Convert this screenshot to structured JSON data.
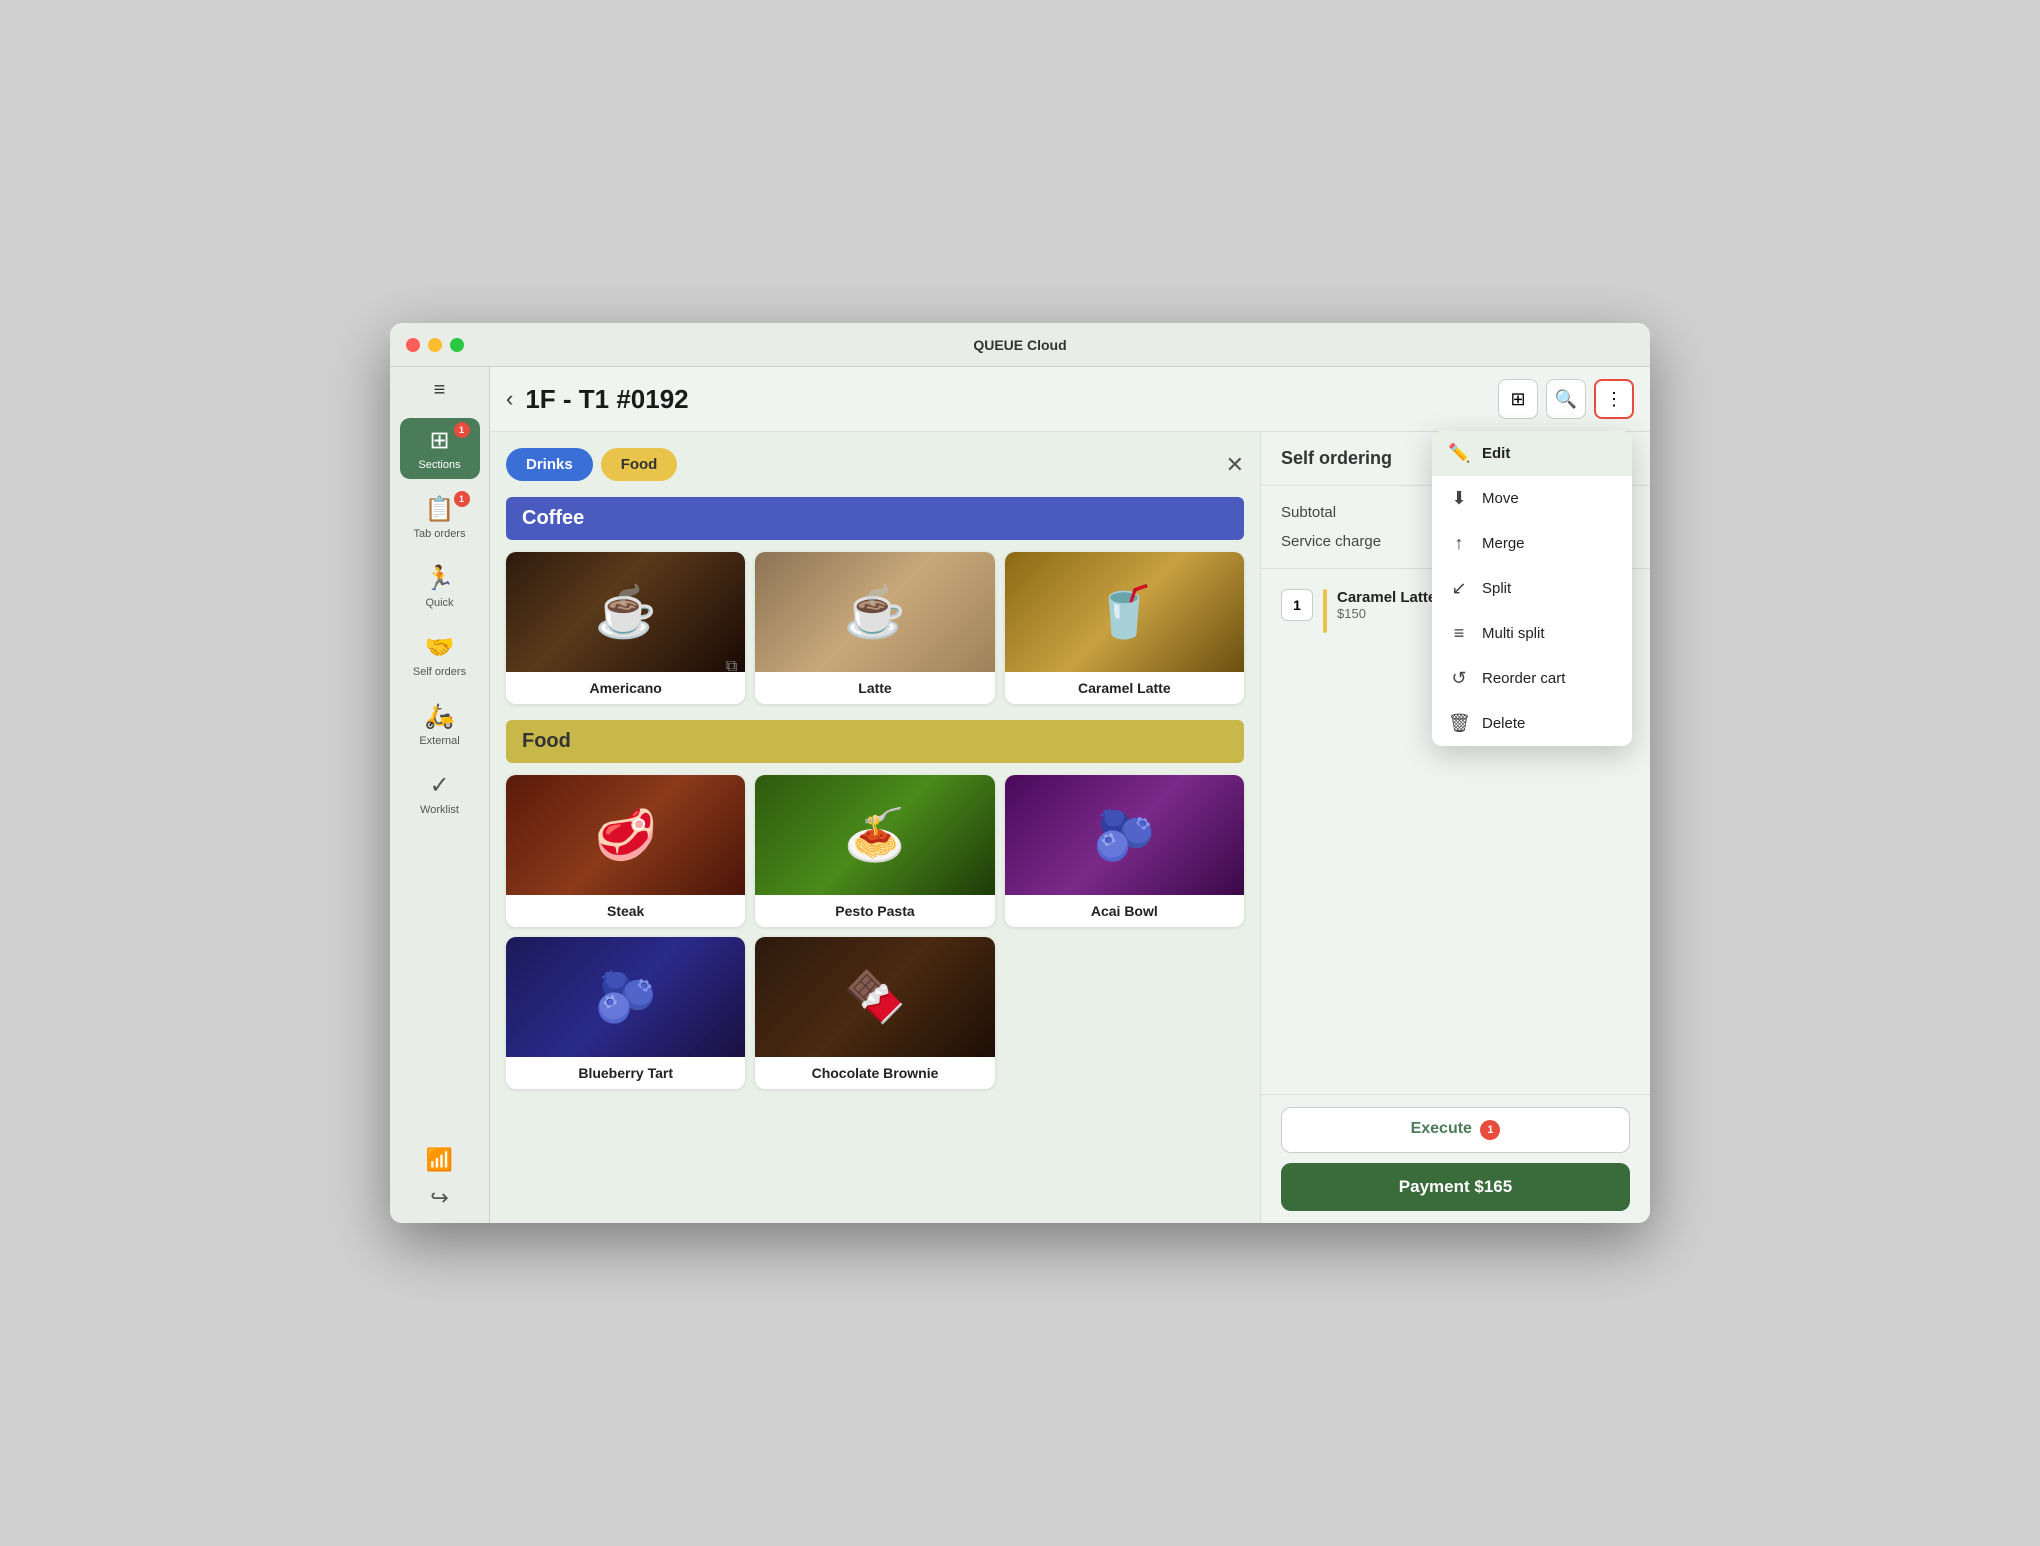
{
  "window": {
    "title": "QUEUE Cloud"
  },
  "header": {
    "back_label": "‹",
    "page_title": "1F - T1 #0192"
  },
  "sidebar": {
    "hamburger": "≡",
    "items": [
      {
        "id": "sections",
        "label": "Sections",
        "icon": "⊞",
        "active": true,
        "badge": 1
      },
      {
        "id": "tab-orders",
        "label": "Tab orders",
        "icon": "📋",
        "active": false,
        "badge": 1
      },
      {
        "id": "quick",
        "label": "Quick",
        "icon": "🏃",
        "active": false,
        "badge": 0
      },
      {
        "id": "self-orders",
        "label": "Self orders",
        "icon": "🤝",
        "active": false,
        "badge": 0
      },
      {
        "id": "external",
        "label": "External",
        "icon": "🛵",
        "active": false,
        "badge": 0
      },
      {
        "id": "worklist",
        "label": "Worklist",
        "icon": "✓",
        "active": false,
        "badge": 0
      }
    ],
    "wifi_icon": "wifi",
    "logout_icon": "logout"
  },
  "filters": {
    "buttons": [
      {
        "id": "drinks",
        "label": "Drinks",
        "style": "active-blue"
      },
      {
        "id": "food",
        "label": "Food",
        "style": "active-yellow"
      }
    ],
    "close_label": "✕"
  },
  "sections": [
    {
      "id": "coffee",
      "label": "Coffee",
      "style": "coffee",
      "items": [
        {
          "id": "americano",
          "name": "Americano",
          "img_class": "img-americano",
          "copy": true
        },
        {
          "id": "latte",
          "name": "Latte",
          "img_class": "img-latte",
          "copy": false
        },
        {
          "id": "caramel-latte",
          "name": "Caramel Latte",
          "img_class": "img-caramel",
          "copy": false
        }
      ]
    },
    {
      "id": "food",
      "label": "Food",
      "style": "food",
      "items": [
        {
          "id": "steak",
          "name": "Steak",
          "img_class": "img-steak",
          "copy": false
        },
        {
          "id": "pesto-pasta",
          "name": "Pesto Pasta",
          "img_class": "img-pasta",
          "copy": false
        },
        {
          "id": "acai-bowl",
          "name": "Acai Bowl",
          "img_class": "img-acai",
          "copy": false
        },
        {
          "id": "blueberry-tart",
          "name": "Blueberry Tart",
          "img_class": "img-blueberry",
          "copy": false
        },
        {
          "id": "chocolate-brownie",
          "name": "Chocolate Brownie",
          "img_class": "img-brownie",
          "copy": false
        }
      ]
    }
  ],
  "right_panel": {
    "order_title": "Self ordering",
    "subtotal_label": "Subtotal",
    "service_charge_label": "Service charge",
    "order_items": [
      {
        "qty": 1,
        "name": "Caramel Latte",
        "price": "$150",
        "accent": true
      }
    ],
    "execute_label": "Execute",
    "execute_badge": "1",
    "payment_label": "Payment $165"
  },
  "dropdown": {
    "items": [
      {
        "id": "edit",
        "icon": "✏️",
        "label": "Edit",
        "highlighted": true
      },
      {
        "id": "move",
        "icon": "⬇️",
        "label": "Move",
        "highlighted": false
      },
      {
        "id": "merge",
        "icon": "↑",
        "label": "Merge",
        "highlighted": false
      },
      {
        "id": "split",
        "icon": "↙",
        "label": "Split",
        "highlighted": false
      },
      {
        "id": "multi-split",
        "icon": "≡",
        "label": "Multi split",
        "highlighted": false
      },
      {
        "id": "reorder-cart",
        "icon": "↺",
        "label": "Reorder cart",
        "highlighted": false
      },
      {
        "id": "delete",
        "icon": "🗑",
        "label": "Delete",
        "highlighted": false
      }
    ]
  },
  "colors": {
    "accent_green": "#4a7c59",
    "section_blue": "#4a5bbf",
    "section_yellow": "#c8b84a",
    "btn_blue": "#3a6fd8",
    "btn_yellow": "#e8c54a",
    "payment_green": "#3a6b3a",
    "badge_red": "#e74c3c"
  }
}
